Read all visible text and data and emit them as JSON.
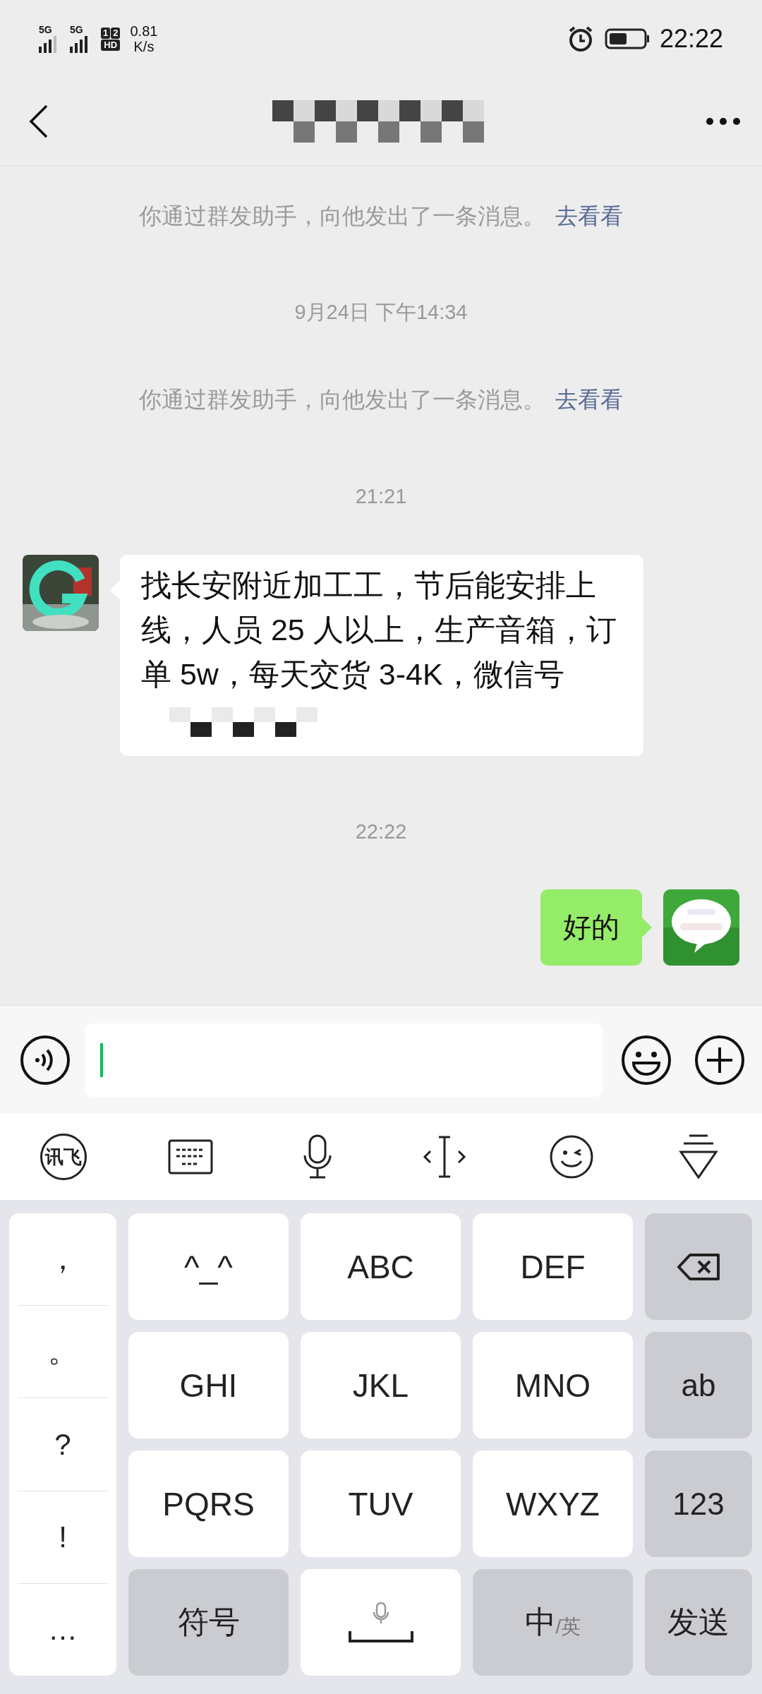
{
  "status_bar": {
    "sims": [
      {
        "label": "5G"
      },
      {
        "label": "5G"
      }
    ],
    "hd_badge": [
      "1",
      "2",
      "HD"
    ],
    "speed_value": "0.81",
    "speed_unit": "K/s",
    "time": "22:22"
  },
  "header": {
    "title_pixelated": true
  },
  "messages": [
    {
      "kind": "system",
      "text": "你通过群发助手，向他发出了一条消息。",
      "link": "去看看"
    },
    {
      "kind": "time",
      "text": "9月24日 下午14:34"
    },
    {
      "kind": "system",
      "text": "你通过群发助手，向他发出了一条消息。",
      "link": "去看看"
    },
    {
      "kind": "time",
      "text": "21:21"
    },
    {
      "kind": "received",
      "text": "找长安附近加工工，节后能安排上线，人员 25 人以上，生产音箱，订单 5w，每天交货 3-4K，微信号",
      "pixelated": true
    },
    {
      "kind": "time",
      "text": "22:22"
    },
    {
      "kind": "sent",
      "text": "好的"
    }
  ],
  "ime_toolbar": {
    "logo": "讯飞"
  },
  "keyboard": {
    "punctuation": [
      "，",
      "。",
      "?",
      "!",
      "…"
    ],
    "keys": [
      {
        "kind": "letter",
        "label": "^_^"
      },
      {
        "kind": "letter",
        "label": "ABC"
      },
      {
        "kind": "letter",
        "label": "DEF"
      },
      {
        "kind": "delete"
      },
      {
        "kind": "letter",
        "label": "GHI"
      },
      {
        "kind": "letter",
        "label": "JKL"
      },
      {
        "kind": "letter",
        "label": "MNO"
      },
      {
        "kind": "function",
        "label": "ab"
      },
      {
        "kind": "letter",
        "label": "PQRS"
      },
      {
        "kind": "letter",
        "label": "TUV"
      },
      {
        "kind": "letter",
        "label": "WXYZ"
      },
      {
        "kind": "function",
        "label": "123"
      },
      {
        "kind": "function",
        "label": "符号"
      },
      {
        "kind": "space"
      },
      {
        "kind": "lang",
        "label": "中",
        "secondary": "/英"
      },
      {
        "kind": "function",
        "label": "发送"
      }
    ]
  }
}
